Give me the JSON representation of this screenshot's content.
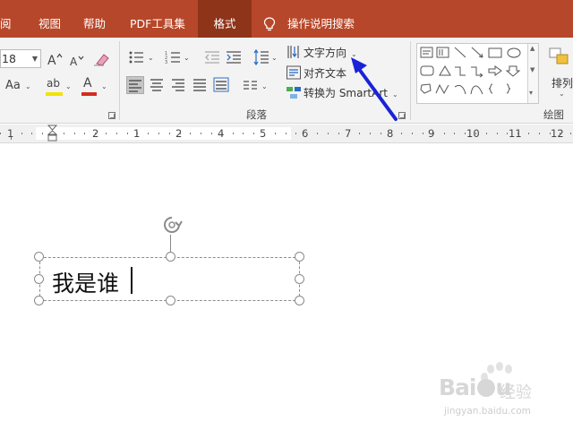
{
  "tabs": [
    {
      "label": "审阅",
      "visible_label": "阅",
      "active": false
    },
    {
      "label": "视图",
      "active": false
    },
    {
      "label": "帮助",
      "active": false
    },
    {
      "label": "PDF工具集",
      "active": false
    },
    {
      "label": "格式",
      "active": true
    },
    {
      "label": "操作说明搜索",
      "active": false
    }
  ],
  "font": {
    "size_value": "18",
    "case_label": "Aa",
    "highlight_label": "ab",
    "color_letter": "A",
    "highlight_color": "#f3e300",
    "font_color": "#d52b1e"
  },
  "paragraph": {
    "label": "段落",
    "text_direction_label": "文字方向",
    "align_text_label": "对齐文本",
    "smartart_label": "转换为 SmartArt"
  },
  "drawing": {
    "label": "绘图",
    "arrange_label": "排列"
  },
  "ruler": {
    "labels": [
      "1",
      "2",
      "1",
      "2",
      "3",
      "4",
      "5",
      "6",
      "7",
      "8",
      "9",
      "10",
      "11",
      "12"
    ]
  },
  "textbox": {
    "text": "我是谁"
  },
  "annotation": {
    "arrow_color": "#1a22d8"
  },
  "watermark": {
    "brand": "Bai",
    "brand_tail": "u",
    "cn": "经验",
    "url": "jingyan.baidu.com"
  },
  "colors": {
    "tab_bar": "#b7472a",
    "active_tab": "#8e3419",
    "ribbon": "#f3f3f3"
  }
}
